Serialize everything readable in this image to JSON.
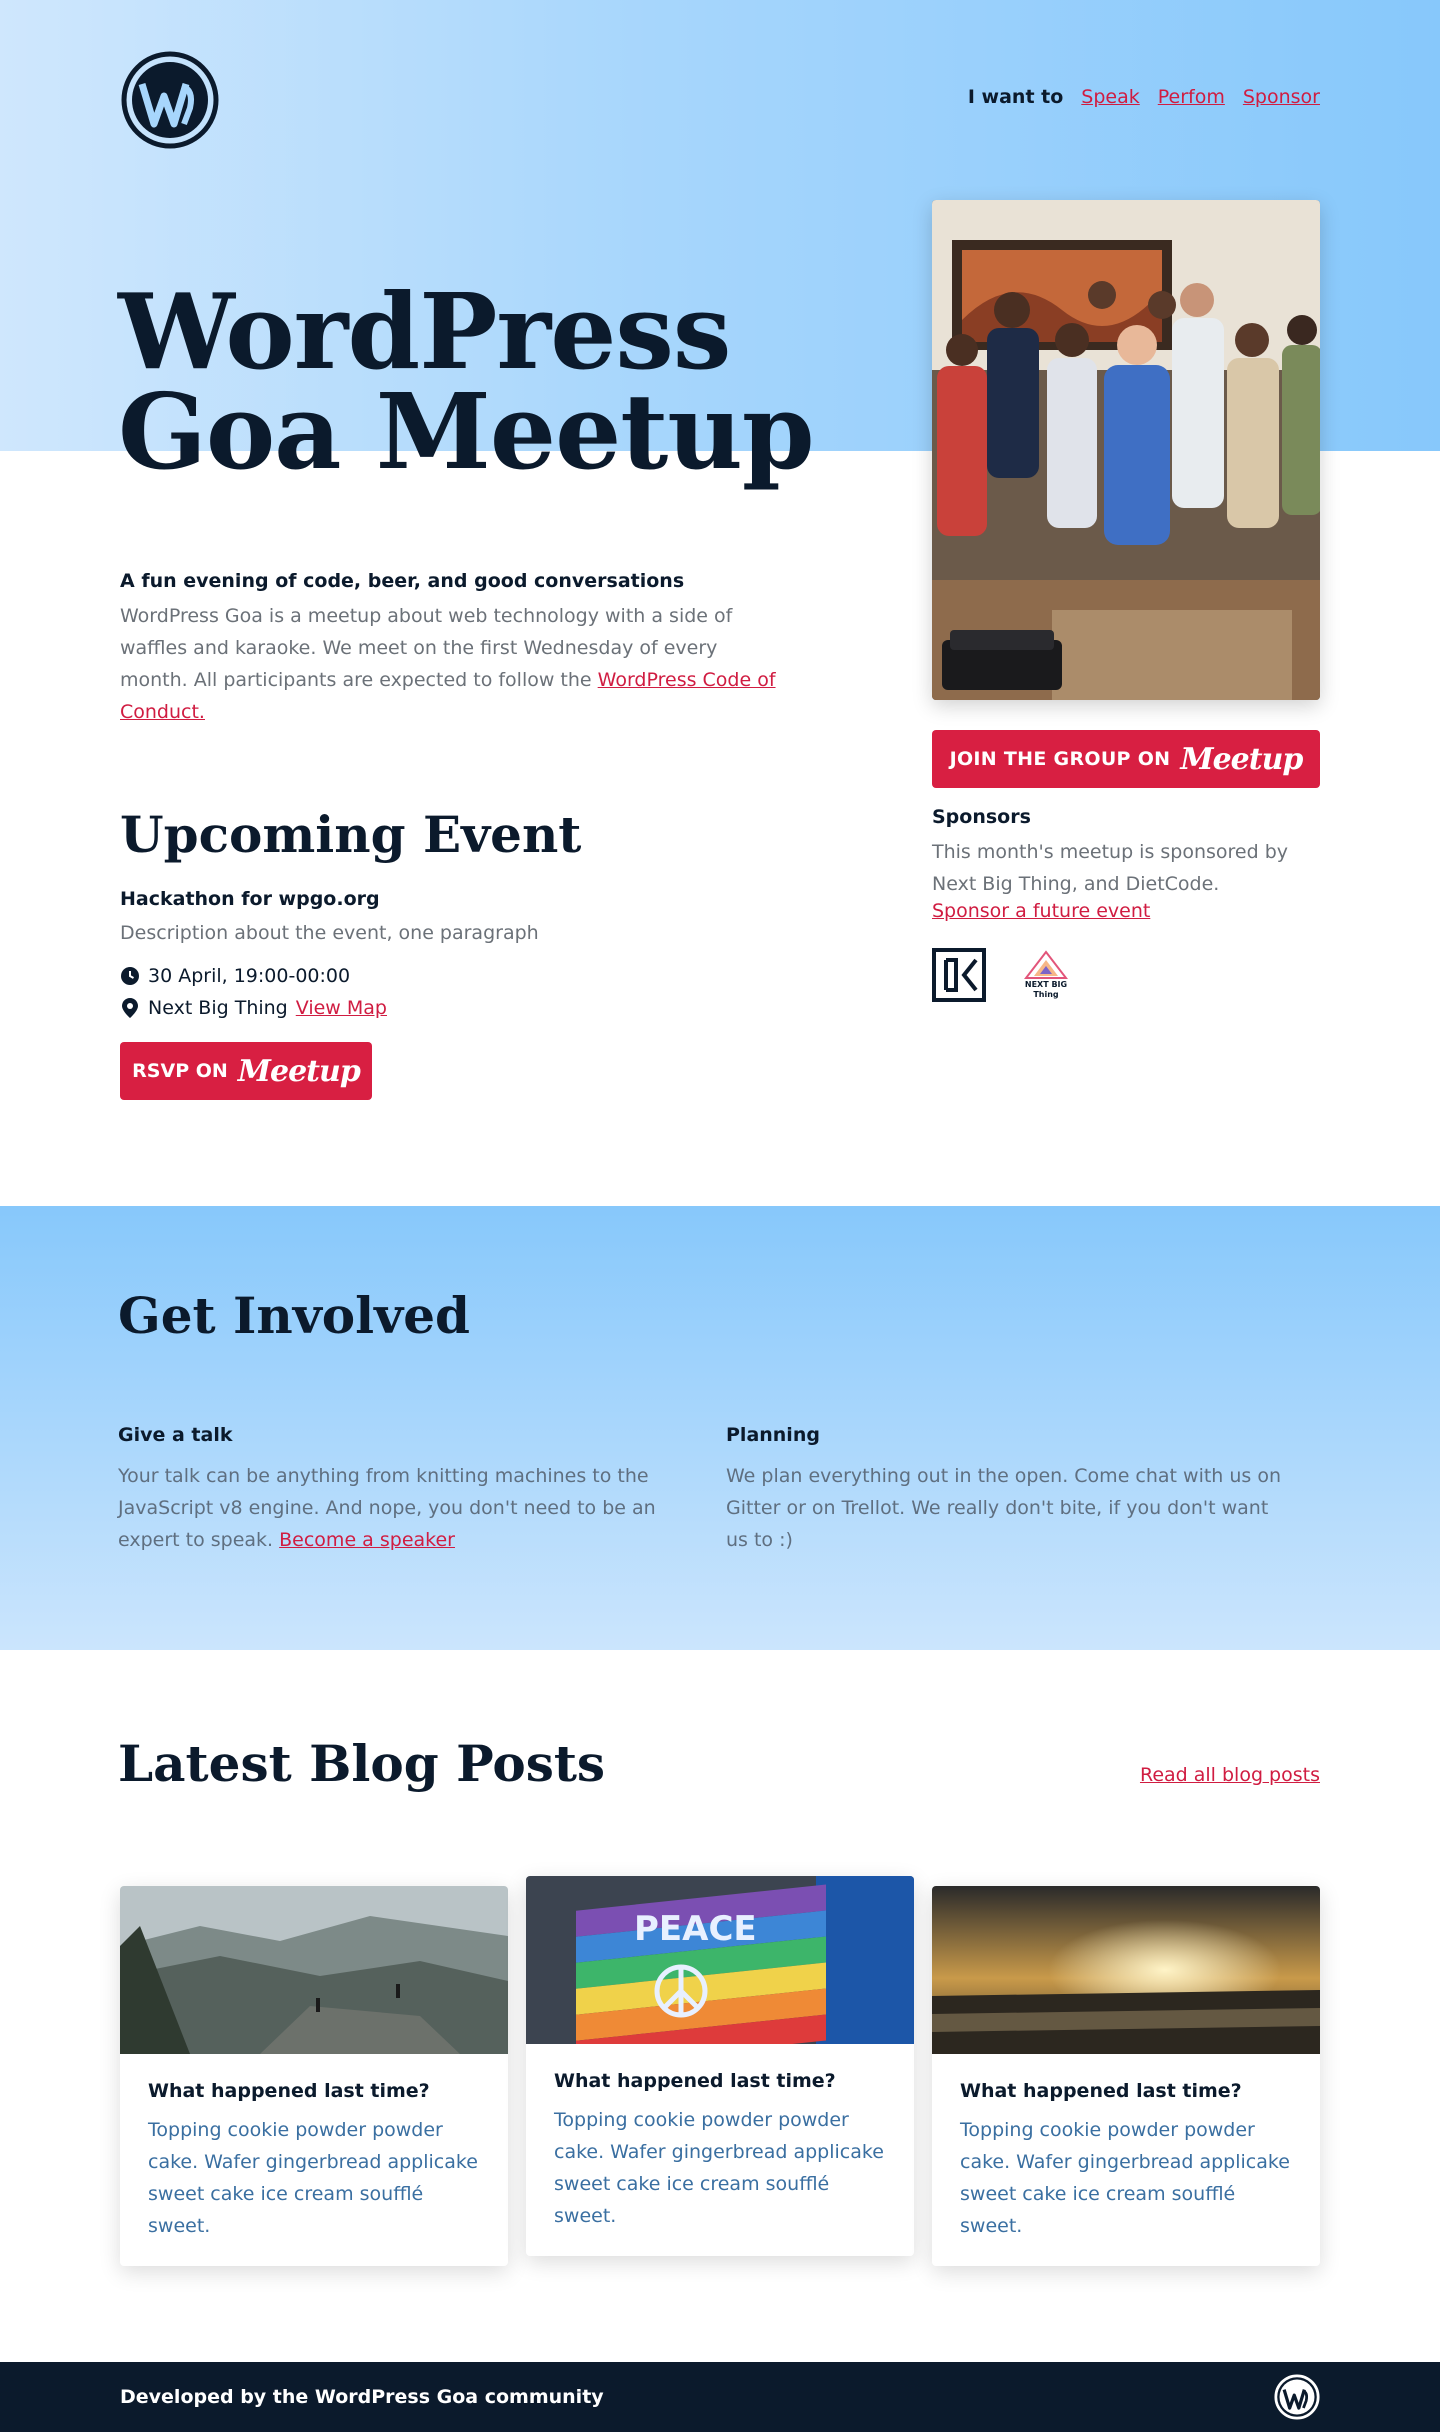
{
  "nav": {
    "label": "I want to",
    "links": [
      "Speak",
      "Perfom",
      "Sponsor"
    ]
  },
  "hero": {
    "title_line1": "WordPress",
    "title_line2": "Goa Meetup"
  },
  "intro": {
    "heading": "A fun evening of code, beer, and good conversations",
    "text": "WordPress Goa is a meetup about web technology with a side of waffles and karaoke. We meet on the first Wednesday of every month. All participants are expected to follow the ",
    "link": "WordPress Code of Conduct."
  },
  "join": {
    "label": "JOIN THE GROUP ON",
    "brand": "Meetup"
  },
  "sponsors": {
    "heading": "Sponsors",
    "text": "This month's meetup is sponsored by Next Big Thing, and DietCode.",
    "link": "Sponsor a future event",
    "nbt_logo_text": "NEXT BIG Thing"
  },
  "event": {
    "heading": "Upcoming Event",
    "title": "Hackathon for wpgo.org",
    "description": "Description about the event, one paragraph",
    "datetime": "30 April, 19:00-00:00",
    "venue": "Next Big Thing",
    "map_link": "View Map",
    "rsvp_label": "RSVP ON",
    "rsvp_brand": "Meetup"
  },
  "involved": {
    "heading": "Get Involved",
    "talk": {
      "title": "Give a talk",
      "text": "Your talk can be anything from knitting machines to the JavaScript v8 engine. And nope, you don't need to be an expert to speak. ",
      "link": "Become a speaker"
    },
    "planning": {
      "title": "Planning",
      "text": "We plan everything out in the open. Come chat with us on Gitter or on Trellot. We really don't bite, if you don't want us to :)"
    }
  },
  "blog": {
    "heading": "Latest Blog Posts",
    "read_all": "Read all blog posts",
    "posts": [
      {
        "title": "What happened last time?",
        "excerpt": "Topping cookie powder powder cake. Wafer gingerbread applicake sweet cake ice cream soufflé sweet."
      },
      {
        "title": "What happened last time?",
        "excerpt": "Topping cookie powder powder cake. Wafer gingerbread applicake sweet cake ice cream soufflé sweet.",
        "banner_text": "PEACE"
      },
      {
        "title": "What happened last time?",
        "excerpt": "Topping cookie powder powder cake. Wafer gingerbread applicake sweet cake ice cream soufflé sweet."
      }
    ]
  },
  "footer": {
    "text": "Developed by the WordPress Goa community"
  },
  "colors": {
    "accent": "#d81f42",
    "navy": "#0b1a2c",
    "sky": "#87c8fb"
  }
}
